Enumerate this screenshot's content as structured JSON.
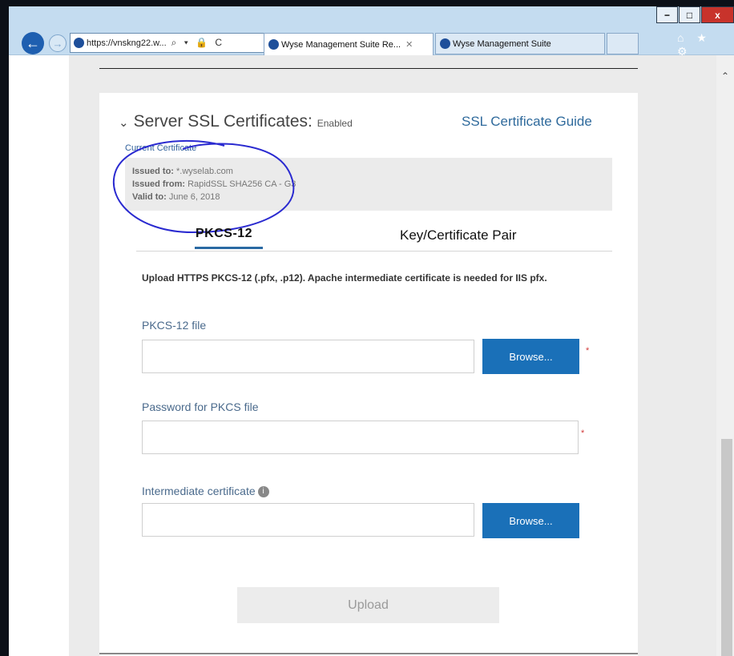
{
  "browser": {
    "url": "https://vnskng22.w...",
    "address_tools": "⌕ ▾ 🔒 C",
    "tabs": [
      {
        "label": "Wyse Management Suite Re...",
        "close": "✕"
      },
      {
        "label": "Wyse Management Suite"
      }
    ],
    "window_buttons": {
      "minimize": "−",
      "maximize": "□",
      "close": "x"
    },
    "toolbar_icons": [
      "home-icon",
      "star-icon",
      "gear-icon"
    ],
    "toolbar_glyphs": "⌂ ★ ⚙"
  },
  "section": {
    "title": "Server SSL Certificates:",
    "status": "Enabled",
    "guide_link": "SSL Certificate Guide",
    "current_certificate_label": "Current Certificate",
    "certificate": {
      "issued_to_label": "Issued to:",
      "issued_to": "*.wyselab.com",
      "issued_from_label": "Issued from:",
      "issued_from": "RapidSSL SHA256 CA - G3",
      "valid_to_label": "Valid to:",
      "valid_to": "June 6, 2018"
    }
  },
  "tabs": {
    "pkcs": "PKCS-12",
    "keypair": "Key/Certificate Pair",
    "active": "PKCS-12"
  },
  "form": {
    "note": "Upload HTTPS PKCS-12 (.pfx, .p12). Apache intermediate certificate is needed for IIS pfx.",
    "pkcs_file_label": "PKCS-12 file",
    "password_label": "Password for PKCS file",
    "intermediate_label": "Intermediate certificate",
    "info_glyph": "i",
    "browse_label": "Browse...",
    "required_mark": "*",
    "upload_label": "Upload"
  },
  "colors": {
    "accent": "#1a70b8",
    "link": "#2f6a9c",
    "annotation": "#2a2ad0"
  }
}
